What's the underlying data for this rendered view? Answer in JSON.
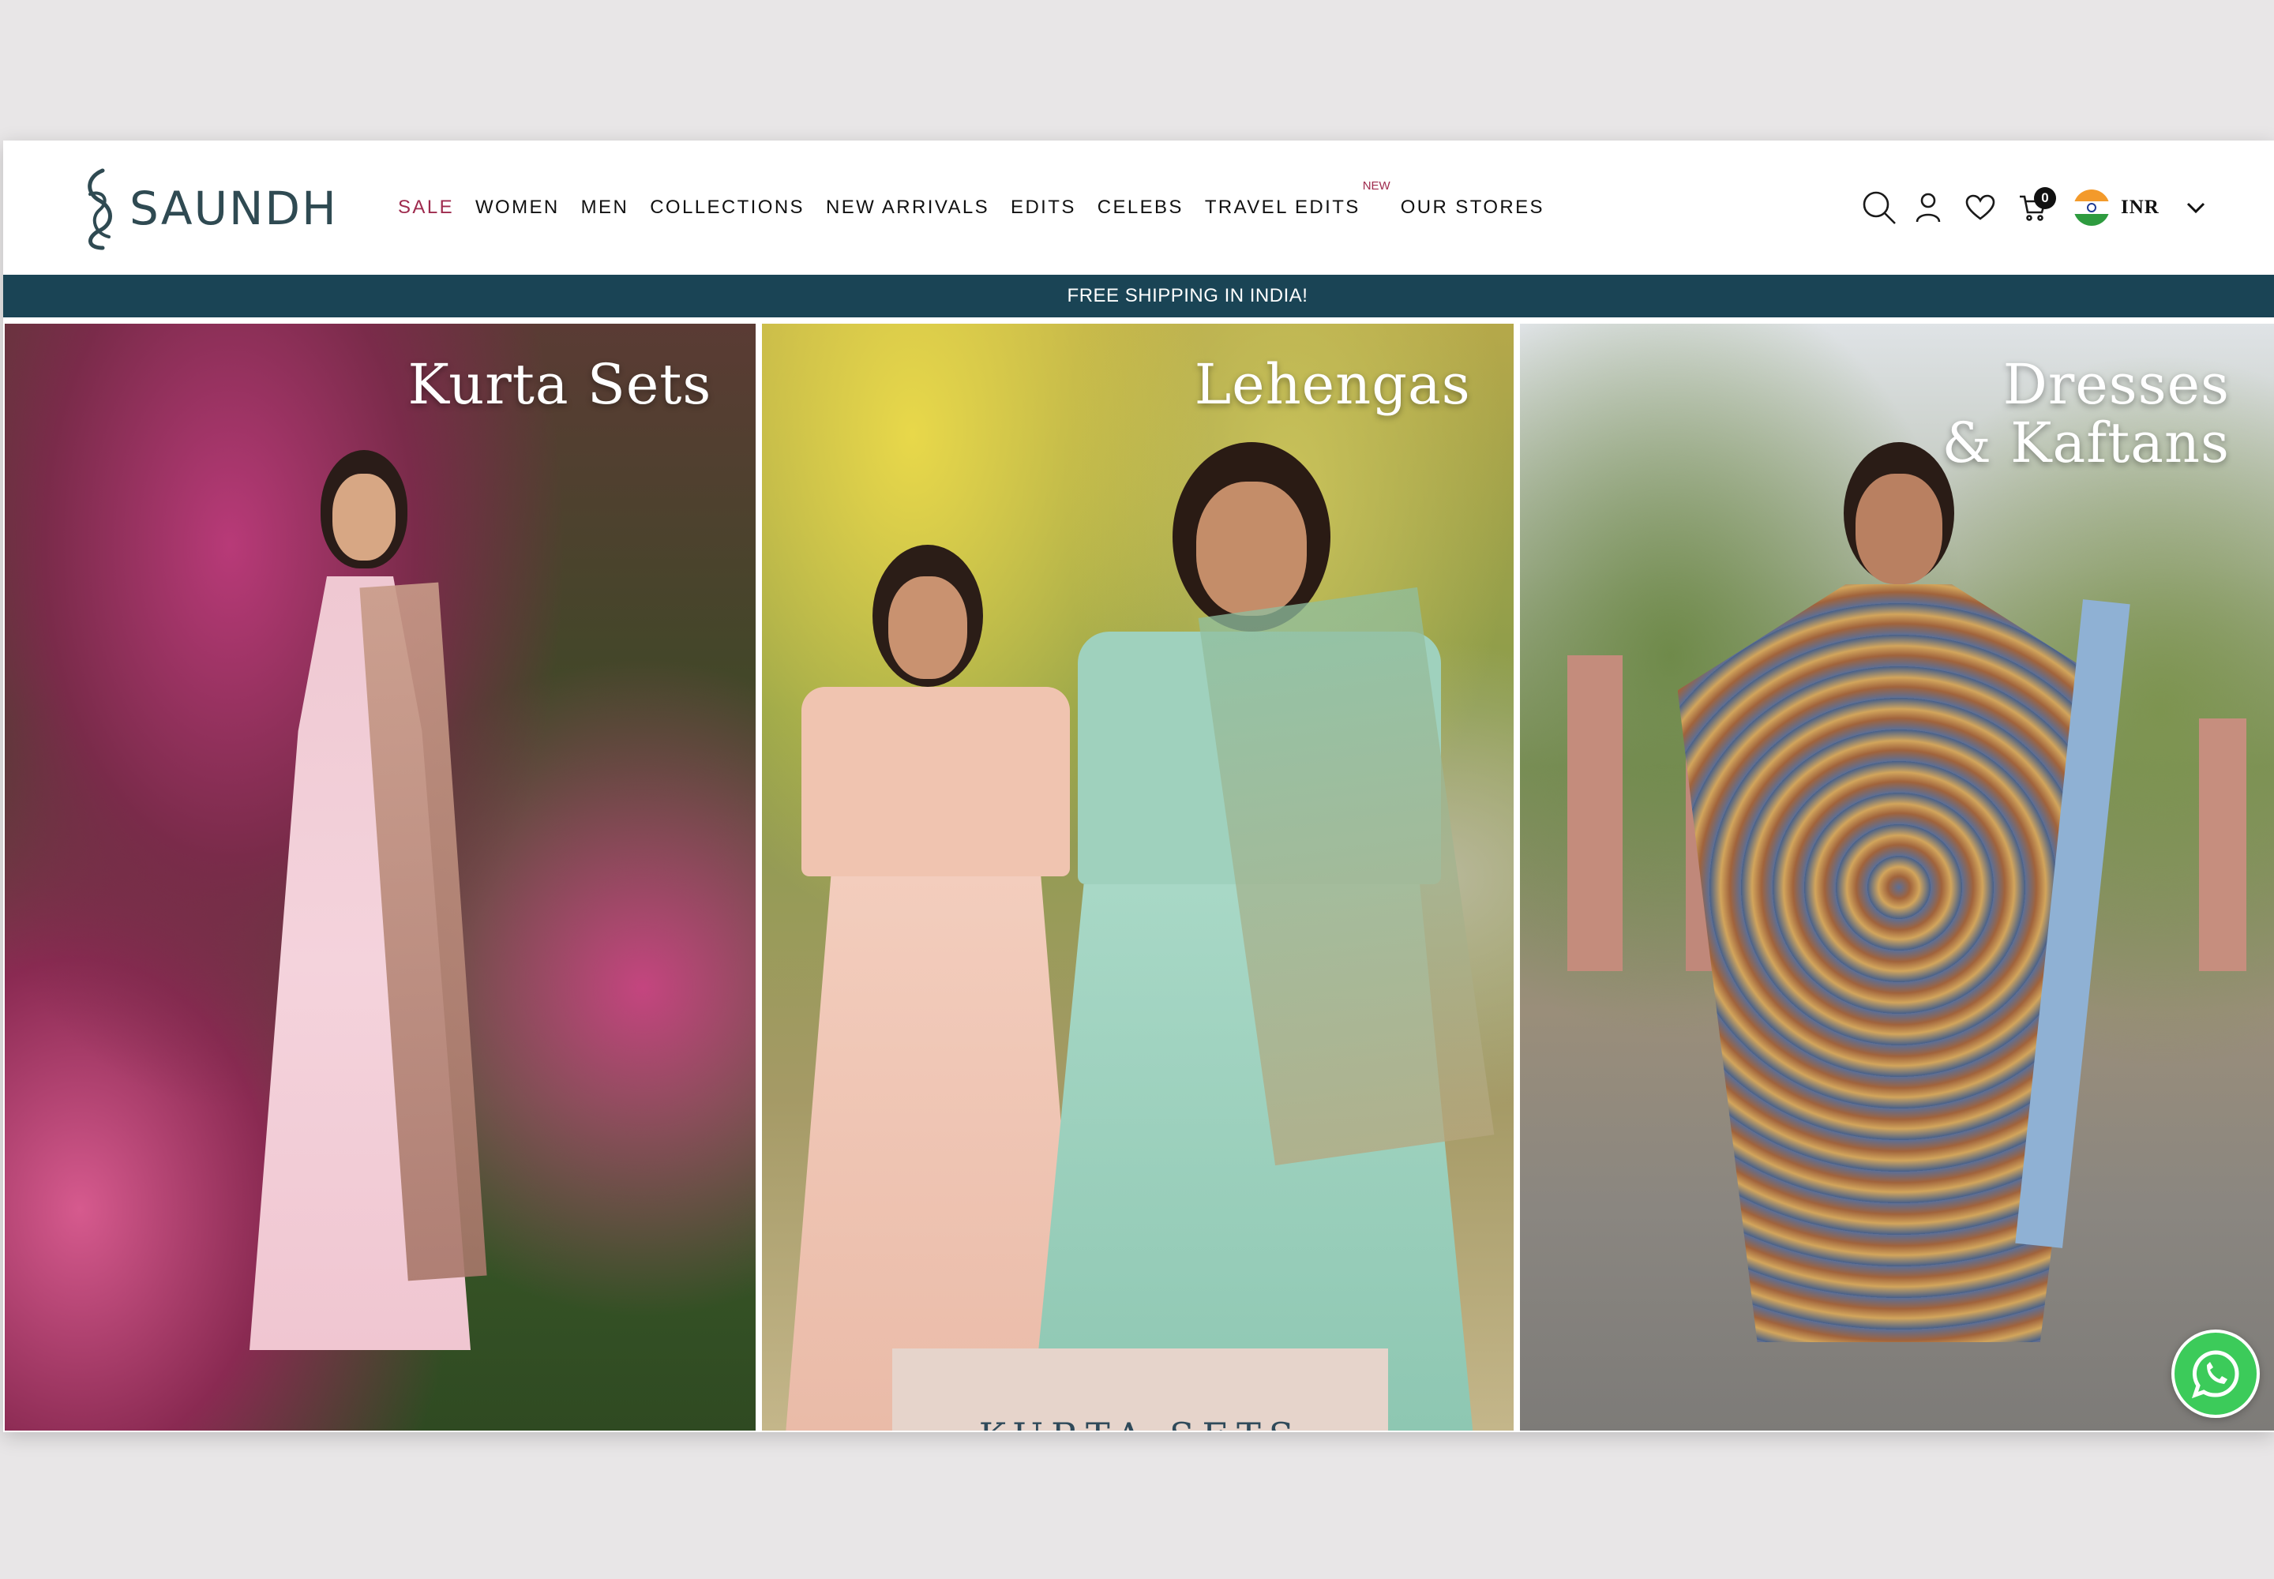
{
  "brand": {
    "name": "SAUNDH"
  },
  "nav": {
    "items": [
      {
        "label": "SALE"
      },
      {
        "label": "WOMEN"
      },
      {
        "label": "MEN"
      },
      {
        "label": "COLLECTIONS"
      },
      {
        "label": "NEW ARRIVALS"
      },
      {
        "label": "EDITS"
      },
      {
        "label": "CELEBS"
      },
      {
        "label": "TRAVEL EDITS",
        "badge": "NEW"
      },
      {
        "label": "OUR STORES"
      }
    ]
  },
  "header": {
    "cart_count": "0",
    "currency": "INR",
    "icons": [
      "search-icon",
      "user-icon",
      "heart-icon",
      "cart-icon",
      "chevron-down-icon"
    ]
  },
  "banner": {
    "text": "FREE SHIPPING IN INDIA!"
  },
  "panels": [
    {
      "title_line1": "Kurta Sets",
      "title_line2": ""
    },
    {
      "title_line1": "Lehengas",
      "title_line2": ""
    },
    {
      "title_line1": "Dresses",
      "title_line2": "& Kaftans"
    }
  ],
  "card": {
    "label": "KURTA SETS"
  },
  "colors": {
    "accent": "#9e2a4d",
    "banner_bg": "#1a4455",
    "whatsapp": "#3ccb5a"
  }
}
